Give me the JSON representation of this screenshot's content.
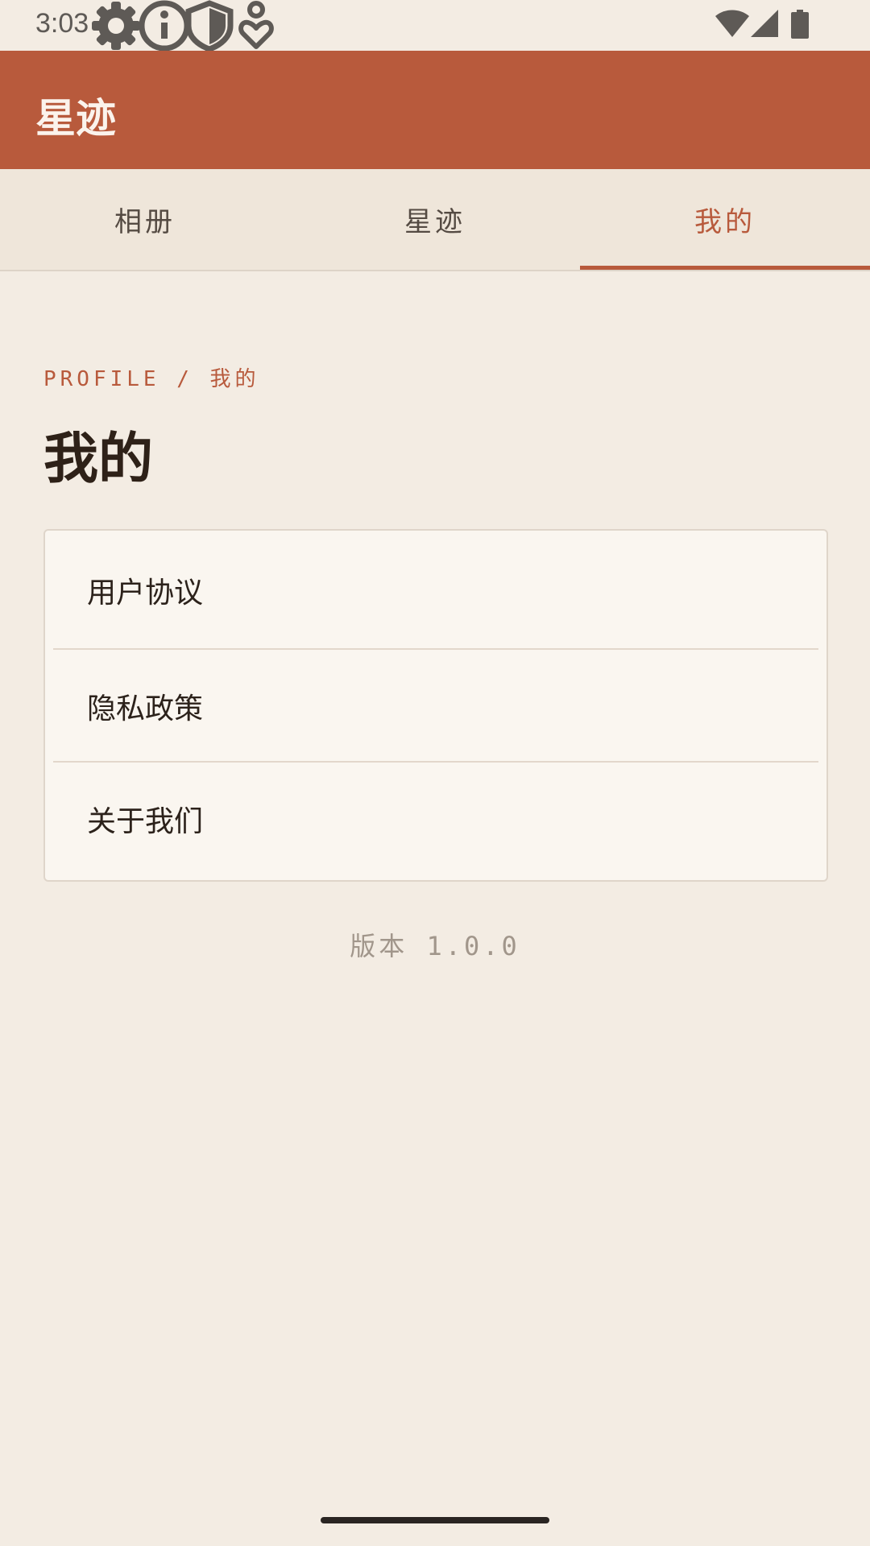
{
  "status_bar": {
    "time": "3:03",
    "left_icons": [
      "gear-icon",
      "info-icon",
      "shield-icon",
      "accessibility-icon"
    ],
    "right_icons": [
      "wifi-icon",
      "cell-signal-icon",
      "battery-icon"
    ]
  },
  "app_bar": {
    "title": "星迹",
    "color": "#b85a3c"
  },
  "tabs": [
    {
      "label": "相册",
      "active": false
    },
    {
      "label": "星迹",
      "active": false
    },
    {
      "label": "我的",
      "active": true
    }
  ],
  "profile": {
    "eyebrow": "PROFILE / 我的",
    "title": "我的"
  },
  "menu": {
    "items": [
      {
        "label": "用户协议"
      },
      {
        "label": "隐私政策"
      },
      {
        "label": "关于我们"
      }
    ]
  },
  "version": "版本 1.0.0",
  "theme": {
    "accent": "#b85a3c",
    "background": "#f3ece3",
    "card": "#faf6f0"
  }
}
